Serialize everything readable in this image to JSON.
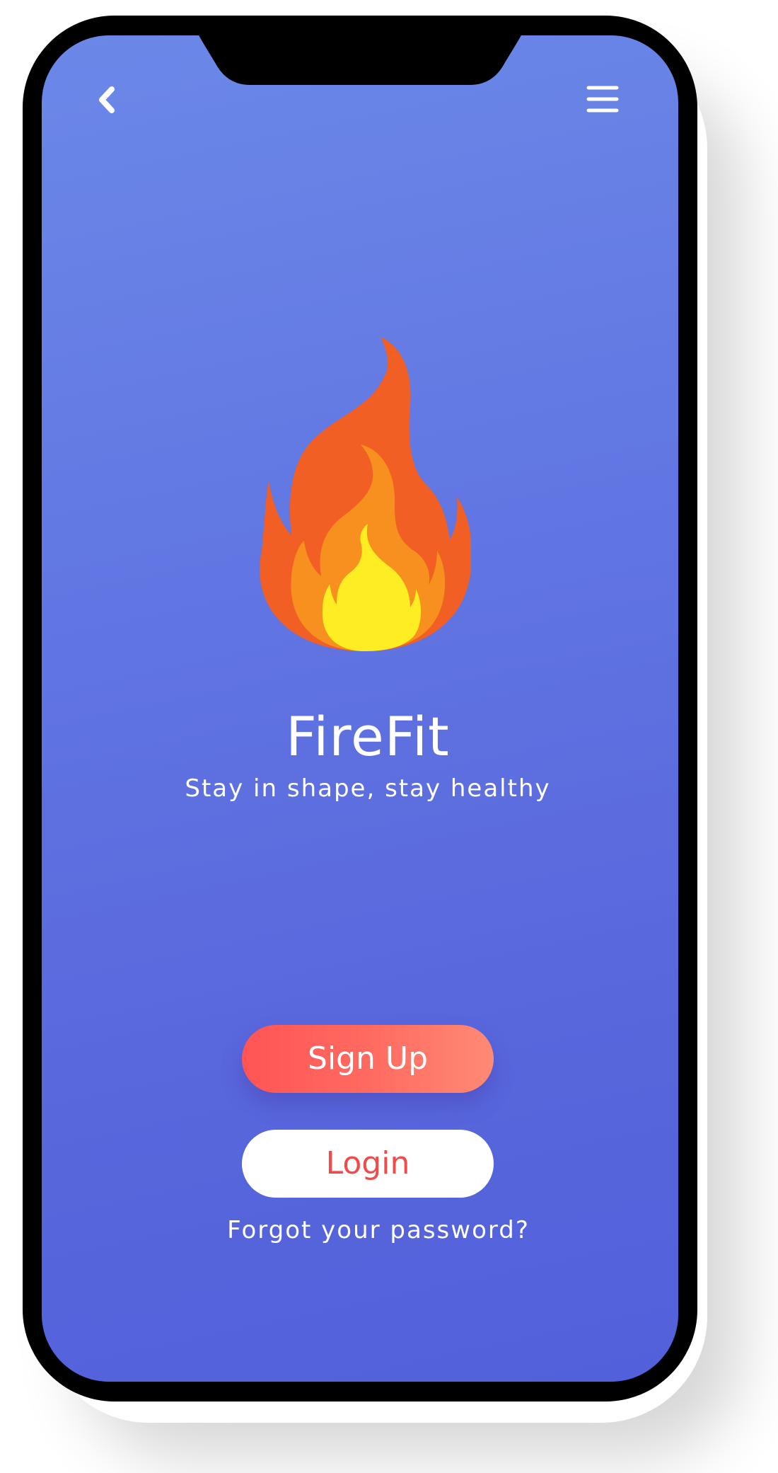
{
  "app": {
    "title": "FireFit",
    "tagline": "Stay in shape, stay healthy"
  },
  "nav": {
    "back_icon": "chevron-left-icon",
    "menu_icon": "hamburger-menu-icon"
  },
  "logo": {
    "icon": "flame-icon"
  },
  "actions": {
    "signup_label": "Sign Up",
    "login_label": "Login",
    "forgot_label": "Forgot your password?"
  },
  "colors": {
    "background_top": "#6B88E8",
    "background_bottom": "#5260DB",
    "signup_gradient_start": "#FF5455",
    "signup_gradient_end": "#FF8A75",
    "login_text": "#F04A4A",
    "flame_outer": "#F15F24",
    "flame_middle": "#F7901E",
    "flame_inner": "#FFED23"
  }
}
